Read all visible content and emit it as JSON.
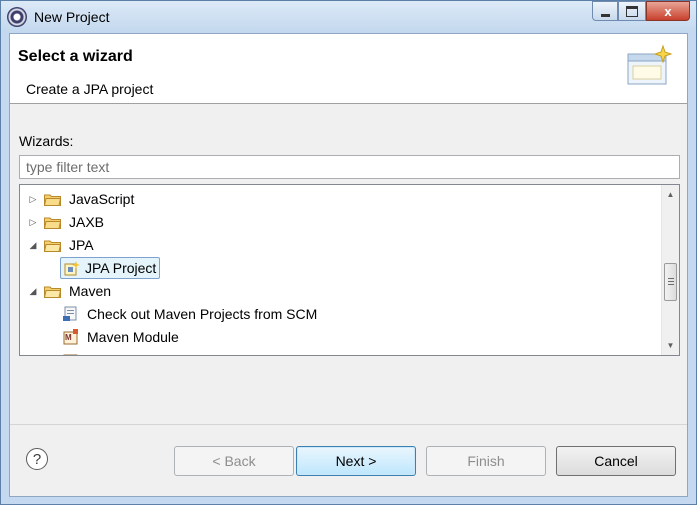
{
  "window": {
    "title": "New Project",
    "close_glyph": "x"
  },
  "header": {
    "title": "Select a wizard",
    "subtitle": "Create a JPA project"
  },
  "filter": {
    "label": "Wizards:",
    "placeholder": "type filter text",
    "value": ""
  },
  "tree": {
    "items": [
      {
        "label": "JavaScript",
        "type": "folder",
        "expanded": false
      },
      {
        "label": "JAXB",
        "type": "folder",
        "expanded": false
      },
      {
        "label": "JPA",
        "type": "folder",
        "expanded": true
      },
      {
        "label": "JPA Project",
        "type": "wizard",
        "selected": true,
        "icon": "jpa-project-icon"
      },
      {
        "label": "Maven",
        "type": "folder",
        "expanded": true
      },
      {
        "label": "Check out Maven Projects from SCM",
        "type": "wizard",
        "icon": "scm-checkout-icon"
      },
      {
        "label": "Maven Module",
        "type": "wizard",
        "icon": "maven-module-icon"
      }
    ]
  },
  "buttons": {
    "help": "?",
    "back": "< Back",
    "next": "Next >",
    "finish": "Finish",
    "cancel": "Cancel"
  },
  "colors": {
    "folder": "#e9b84a",
    "selection": "#e5f3fb",
    "default_button": "#3c7fb1"
  }
}
